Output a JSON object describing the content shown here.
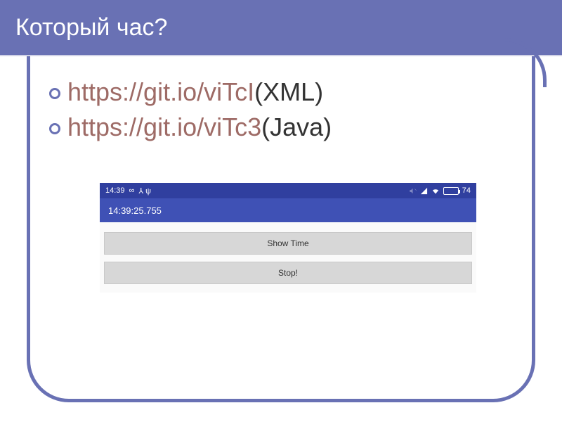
{
  "slide": {
    "title": "Который час?"
  },
  "bullets": [
    {
      "link": "https://git.io/viTcI",
      "suffix": " (XML)"
    },
    {
      "link": "https://git.io/viTc3",
      "suffix": " (Java)"
    }
  ],
  "phone": {
    "status": {
      "time": "14:39",
      "infinity": "∞",
      "icons": "⅄ ψ",
      "battery_pct": "74"
    },
    "actionbar_time": "14:39:25.755",
    "buttons": {
      "show": "Show Time",
      "stop": "Stop!"
    }
  }
}
